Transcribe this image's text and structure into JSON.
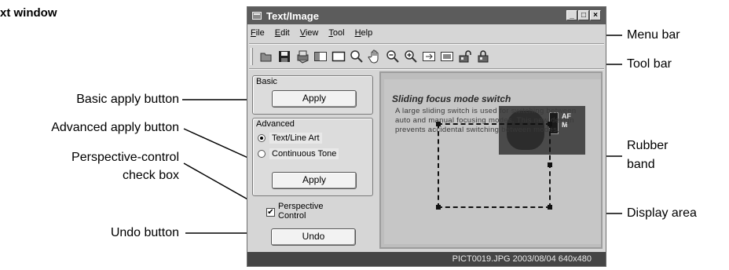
{
  "heading": "xt window",
  "window": {
    "title": "Text/Image",
    "controls": [
      "_",
      "□",
      "×"
    ]
  },
  "menu": {
    "items": [
      {
        "key": "F",
        "rest": "ile"
      },
      {
        "key": "E",
        "rest": "dit"
      },
      {
        "key": "V",
        "rest": "iew"
      },
      {
        "key": "T",
        "rest": "ool"
      },
      {
        "key": "H",
        "rest": "elp"
      }
    ]
  },
  "toolbar": {
    "icons": [
      "open-icon",
      "save-icon",
      "print-icon",
      "split-view-icon",
      "frame-icon",
      "magnifier-icon",
      "hand-icon",
      "zoom-out-icon",
      "zoom-in-icon",
      "fit-window-icon",
      "full-view-icon",
      "lock-open-icon",
      "lock-closed-icon"
    ]
  },
  "panel": {
    "basic_label": "Basic",
    "basic_apply": "Apply",
    "advanced_label": "Advanced",
    "radio_text_line_art": "Text/Line Art",
    "radio_continuous_tone": "Continuous Tone",
    "selected_radio": "Text/Line Art",
    "advanced_apply": "Apply",
    "perspective_line1": "Perspective",
    "perspective_line2": "Control",
    "perspective_checked": "✔",
    "undo": "Undo"
  },
  "display": {
    "photo_title": "Sliding focus mode switch",
    "photo_text": "A large sliding switch is used for switching between auto and manual focusing modes. This new design prevents accidental switching between modes.",
    "camera_af": "AF",
    "camera_m": "M"
  },
  "status": {
    "text": "PICT0019.JPG 2003/08/04 640x480"
  },
  "callouts": {
    "basic_apply": "Basic apply button",
    "advanced_apply": "Advanced apply button",
    "perspective_1": "Perspective-control",
    "perspective_2": "check box",
    "undo": "Undo button",
    "menu_bar": "Menu bar",
    "tool_bar": "Tool bar",
    "rubber_1": "Rubber",
    "rubber_2": "band",
    "display_area": "Display area"
  }
}
